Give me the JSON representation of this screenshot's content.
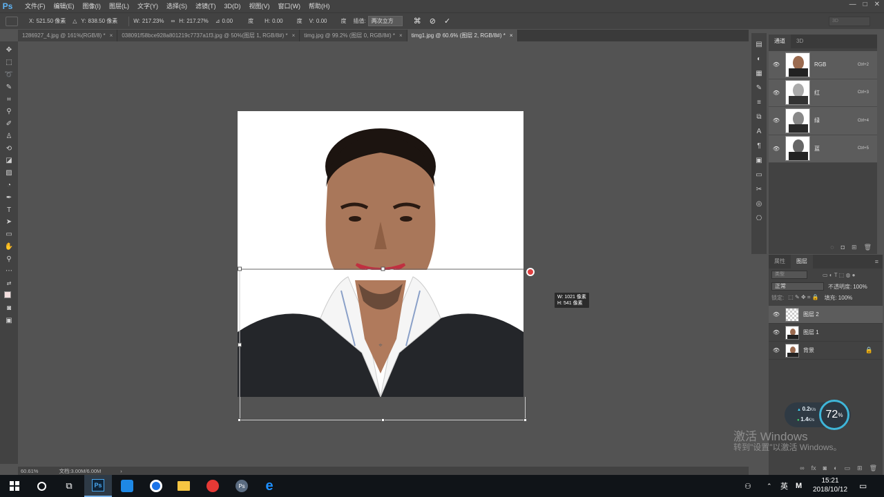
{
  "app": {
    "logo": "Ps",
    "menu": [
      "文件(F)",
      "编辑(E)",
      "图像(I)",
      "图层(L)",
      "文字(Y)",
      "选择(S)",
      "滤镜(T)",
      "3D(D)",
      "视图(V)",
      "窗口(W)",
      "帮助(H)"
    ],
    "window_controls": [
      "—",
      "□",
      "✕"
    ]
  },
  "options": {
    "x_label": "X:",
    "x_value": "521.50 像素",
    "y_label": "Y:",
    "y_value": "838.50 像素",
    "w_label": "W:",
    "w_value": "217.23%",
    "h_label": "H:",
    "h_value": "217.27%",
    "angle_value": "0.00",
    "angle_unit": "度",
    "hskew_label": "H:",
    "hskew_value": "0.00",
    "hskew_unit": "度",
    "vskew_label": "V:",
    "vskew_value": "0.00",
    "vskew_unit": "度",
    "interp_label": "插值:",
    "interp_value": "两次立方",
    "threed_placeholder": "3D"
  },
  "tabs": [
    {
      "label": "1286927_4.jpg @ 161%(RGB/8) *"
    },
    {
      "label": "038091f58bce928a801219c7737a1f3.jpg @ 50%(图层 1, RGB/8#) *"
    },
    {
      "label": "timg.jpg @ 99.2% (图层 0, RGB/8#) *"
    },
    {
      "label": "timg1.jpg @ 60.6% (图层 2, RGB/8#) *"
    }
  ],
  "transform_readout": {
    "w": "W:  1021 像素",
    "h": "H:    541 像素"
  },
  "status": {
    "zoom": "60.61%",
    "doc": "文档:3.00M/6.00M",
    "arrow": "›"
  },
  "channels_panel": {
    "tabs": [
      "通道",
      "3D"
    ],
    "rows": [
      {
        "name": "RGB",
        "key": "Ctrl+2"
      },
      {
        "name": "红",
        "key": "Ctrl+3"
      },
      {
        "name": "绿",
        "key": "Ctrl+4"
      },
      {
        "name": "蓝",
        "key": "Ctrl+5"
      }
    ]
  },
  "layers_panel": {
    "tabs": [
      "属性",
      "图层"
    ],
    "search_placeholder": "类型",
    "blend_mode": "正常",
    "opacity_label": "不透明度:",
    "opacity_value": "100%",
    "lock_label": "锁定:",
    "fill_label": "填充:",
    "fill_value": "100%",
    "layers": [
      {
        "name": "图层 2",
        "selected": true
      },
      {
        "name": "图层 1",
        "selected": false
      },
      {
        "name": "背景",
        "selected": false
      }
    ]
  },
  "net_widget": {
    "up": "0.2",
    "up_unit": "K/s",
    "down": "1.4",
    "down_unit": "K/s",
    "percent": "72",
    "percent_unit": "%"
  },
  "watermark": {
    "line1": "激活 Windows",
    "line2": "转到\"设置\"以激活 Windows。"
  },
  "taskbar": {
    "time": "15:21",
    "date": "2018/10/12",
    "ime": "英",
    "ime2": "M"
  }
}
